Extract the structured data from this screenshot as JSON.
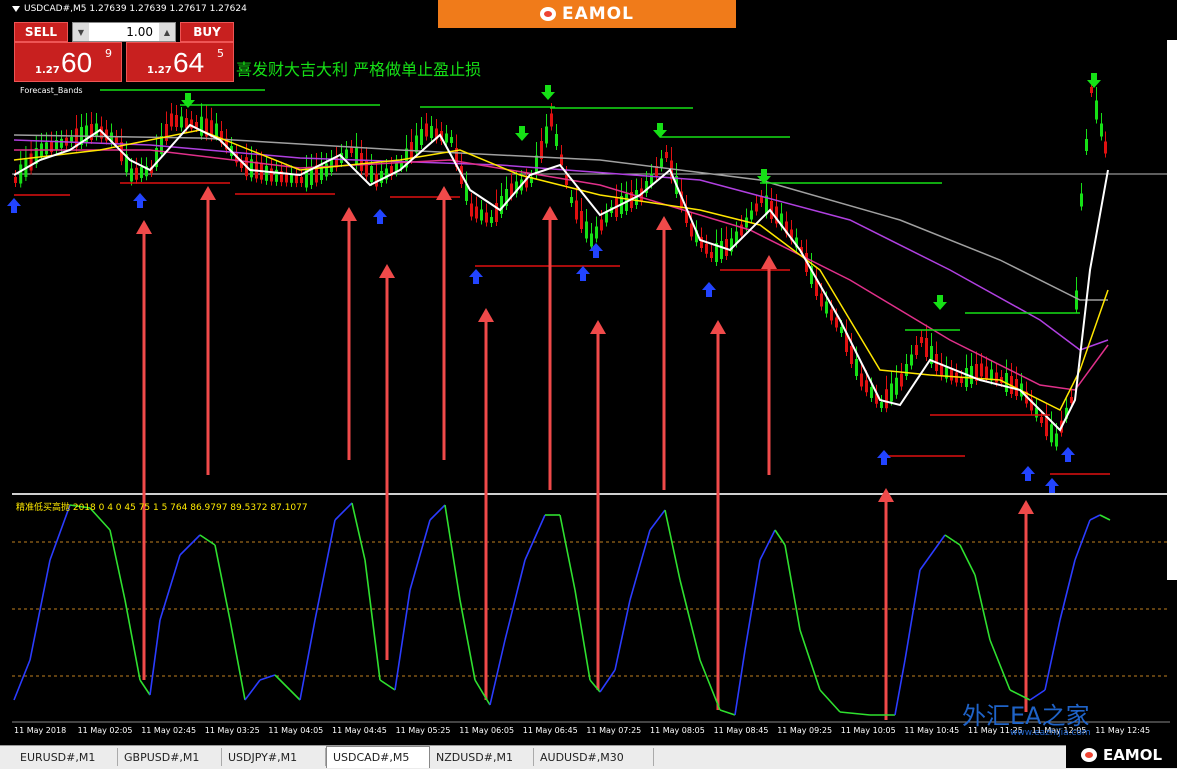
{
  "header": {
    "symbol_title": "USDCAD#,M5  1.27639 1.27639 1.27617 1.27624"
  },
  "brand": {
    "name": "EAMOL"
  },
  "trade_panel": {
    "sell_label": "SELL",
    "buy_label": "BUY",
    "lot": "1.00",
    "sell_prefix": "1.27",
    "sell_big": "60",
    "sell_sup": "9",
    "buy_prefix": "1.27",
    "buy_big": "64",
    "buy_sup": "5"
  },
  "slogan": "喜发财大吉大利   严格做单止盈止损",
  "indicator_name": "Forecast_Bands",
  "oscillator_label": "精准低买高抛 2018 0 4 0 45 75 1 5 764 86.9797 89.5372 87.1077",
  "time_axis": [
    "11 May 2018",
    "11 May 02:05",
    "11 May 02:45",
    "11 May 03:25",
    "11 May 04:05",
    "11 May 04:45",
    "11 May 05:25",
    "11 May 06:05",
    "11 May 06:45",
    "11 May 07:25",
    "11 May 08:05",
    "11 May 08:45",
    "11 May 09:25",
    "11 May 10:05",
    "11 May 10:45",
    "11 May 11:25",
    "11 May 12:05",
    "11 May 12:45"
  ],
  "tabs": [
    {
      "label": "EURUSD#,M1",
      "active": false
    },
    {
      "label": "GBPUSD#,M1",
      "active": false
    },
    {
      "label": "USDJPY#,M1",
      "active": false
    },
    {
      "label": "USDCAD#,M5",
      "active": true
    },
    {
      "label": "NZDUSD#,M1",
      "active": false
    },
    {
      "label": "AUDUSD#,M30",
      "active": false
    }
  ],
  "watermark": {
    "text": "外汇EA之家",
    "url": "www.eazhijia.com"
  },
  "colors": {
    "bull": "#16e016",
    "bear": "#e01010",
    "buy_arrow": "#2244ff",
    "sell_arrow": "#16e016",
    "signal_arrow": "#f04a4a"
  }
}
